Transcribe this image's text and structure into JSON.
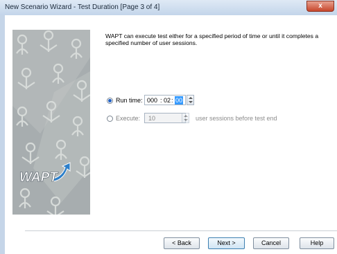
{
  "window": {
    "title": "New Scenario Wizard - Test Duration [Page 3 of 4]",
    "close_glyph": "x"
  },
  "branding": {
    "logo_text": "WAPT"
  },
  "description": {
    "line1": "WAPT can execute test either for a specified period of time or until it completes a",
    "line2": "specified number of user sessions."
  },
  "options": {
    "run_time": {
      "label": "Run time:",
      "selected": true,
      "hours": "000",
      "minutes": "02",
      "seconds": "00",
      "separator": ":"
    },
    "execute": {
      "label": "Execute:",
      "selected": false,
      "value": "10",
      "suffix": "user sessions before test end"
    }
  },
  "buttons": {
    "back": "< Back",
    "next": "Next >",
    "cancel": "Cancel",
    "help": "Help"
  },
  "colors": {
    "accent": "#3399ff",
    "logo_blue": "#2d7fc9",
    "selection": "#3399ff"
  }
}
